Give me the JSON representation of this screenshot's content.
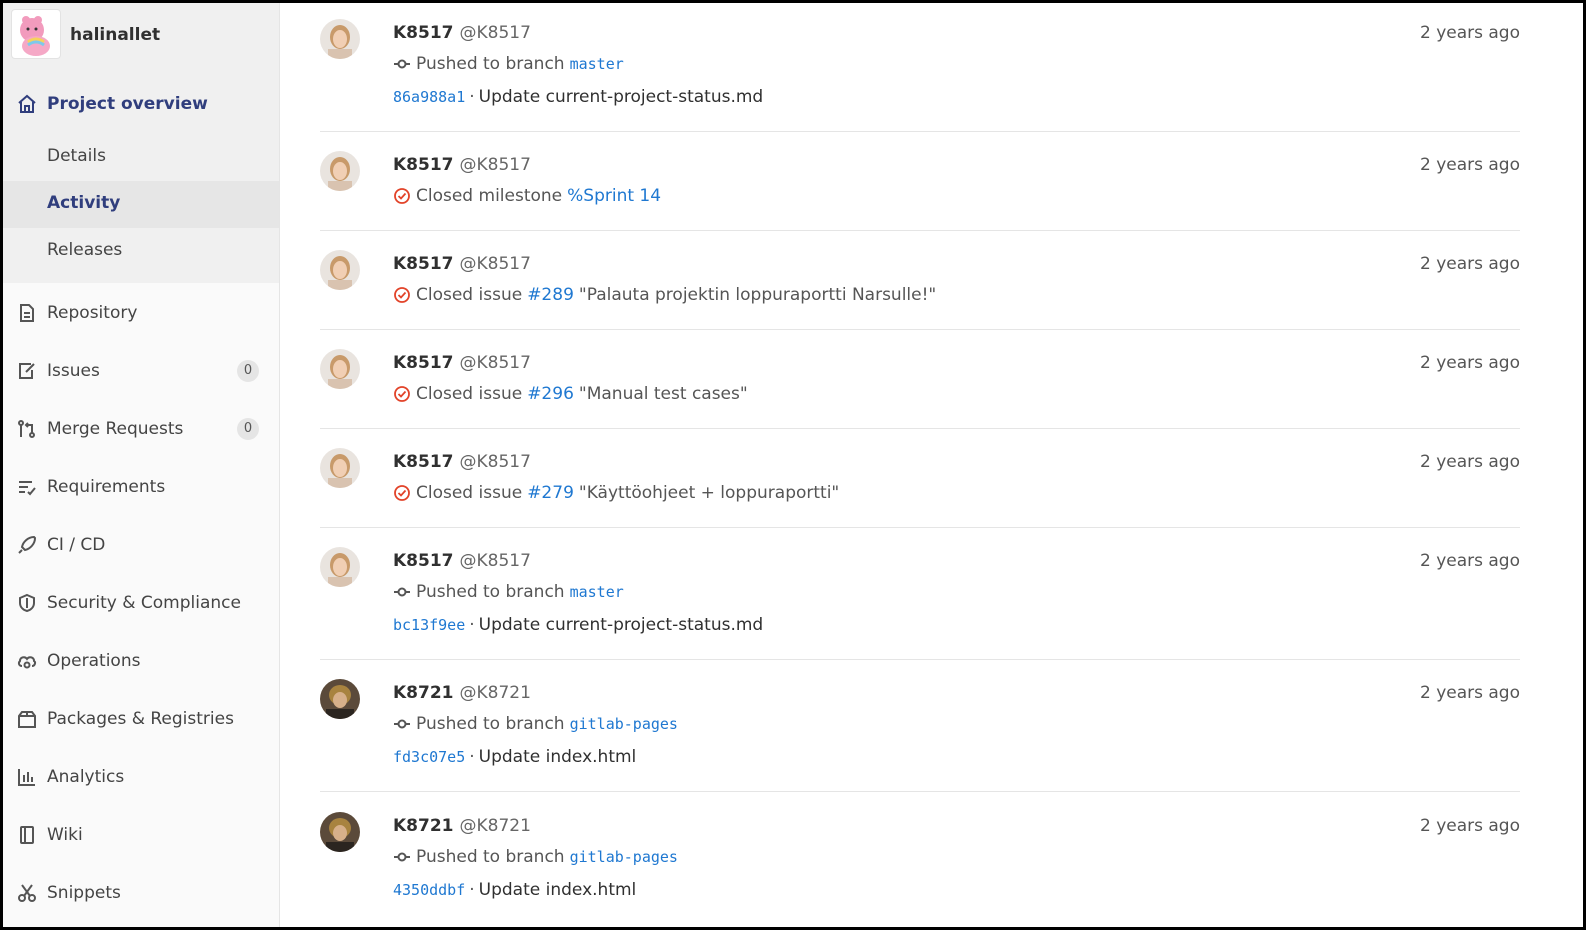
{
  "project": {
    "name": "halinallet"
  },
  "sidebar": {
    "overview": "Project overview",
    "sub_items": [
      "Details",
      "Activity",
      "Releases"
    ],
    "items": [
      {
        "label": "Repository",
        "icon": "document-icon"
      },
      {
        "label": "Issues",
        "icon": "issues-icon",
        "badge": "0"
      },
      {
        "label": "Merge Requests",
        "icon": "merge-request-icon",
        "badge": "0"
      },
      {
        "label": "Requirements",
        "icon": "requirements-icon"
      },
      {
        "label": "CI / CD",
        "icon": "rocket-icon"
      },
      {
        "label": "Security & Compliance",
        "icon": "shield-icon"
      },
      {
        "label": "Operations",
        "icon": "cloud-gear-icon"
      },
      {
        "label": "Packages & Registries",
        "icon": "package-icon"
      },
      {
        "label": "Analytics",
        "icon": "chart-icon"
      },
      {
        "label": "Wiki",
        "icon": "book-icon"
      },
      {
        "label": "Snippets",
        "icon": "scissors-icon"
      }
    ]
  },
  "events": [
    {
      "name": "K8517",
      "handle": "@K8517",
      "time": "2 years ago",
      "action": "Pushed to branch",
      "target": "master",
      "target_mono": true,
      "commit_sha": "86a988a1",
      "commit_msg": "Update current-project-status.md",
      "kind": "push",
      "avatar": "woman"
    },
    {
      "name": "K8517",
      "handle": "@K8517",
      "time": "2 years ago",
      "action": "Closed milestone",
      "target": "%Sprint 14",
      "kind": "closed",
      "avatar": "woman"
    },
    {
      "name": "K8517",
      "handle": "@K8517",
      "time": "2 years ago",
      "action": "Closed issue",
      "target": "#289",
      "title": "\"Palauta projektin loppuraportti Narsulle!\"",
      "kind": "closed",
      "avatar": "woman"
    },
    {
      "name": "K8517",
      "handle": "@K8517",
      "time": "2 years ago",
      "action": "Closed issue",
      "target": "#296",
      "title": "\"Manual test cases\"",
      "kind": "closed",
      "avatar": "woman"
    },
    {
      "name": "K8517",
      "handle": "@K8517",
      "time": "2 years ago",
      "action": "Closed issue",
      "target": "#279",
      "title": "\"Käyttöohjeet + loppuraportti\"",
      "kind": "closed",
      "avatar": "woman"
    },
    {
      "name": "K8517",
      "handle": "@K8517",
      "time": "2 years ago",
      "action": "Pushed to branch",
      "target": "master",
      "target_mono": true,
      "commit_sha": "bc13f9ee",
      "commit_msg": "Update current-project-status.md",
      "kind": "push",
      "avatar": "woman"
    },
    {
      "name": "K8721",
      "handle": "@K8721",
      "time": "2 years ago",
      "action": "Pushed to branch",
      "target": "gitlab-pages",
      "target_mono": true,
      "commit_sha": "fd3c07e5",
      "commit_msg": "Update index.html",
      "kind": "push",
      "avatar": "man"
    },
    {
      "name": "K8721",
      "handle": "@K8721",
      "time": "2 years ago",
      "action": "Pushed to branch",
      "target": "gitlab-pages",
      "target_mono": true,
      "commit_sha": "4350ddbf",
      "commit_msg": "Update index.html",
      "kind": "push",
      "avatar": "man"
    }
  ],
  "colors": {
    "accent": "#1f78d1",
    "closed": "#e24329",
    "active_nav": "#303e7d"
  }
}
